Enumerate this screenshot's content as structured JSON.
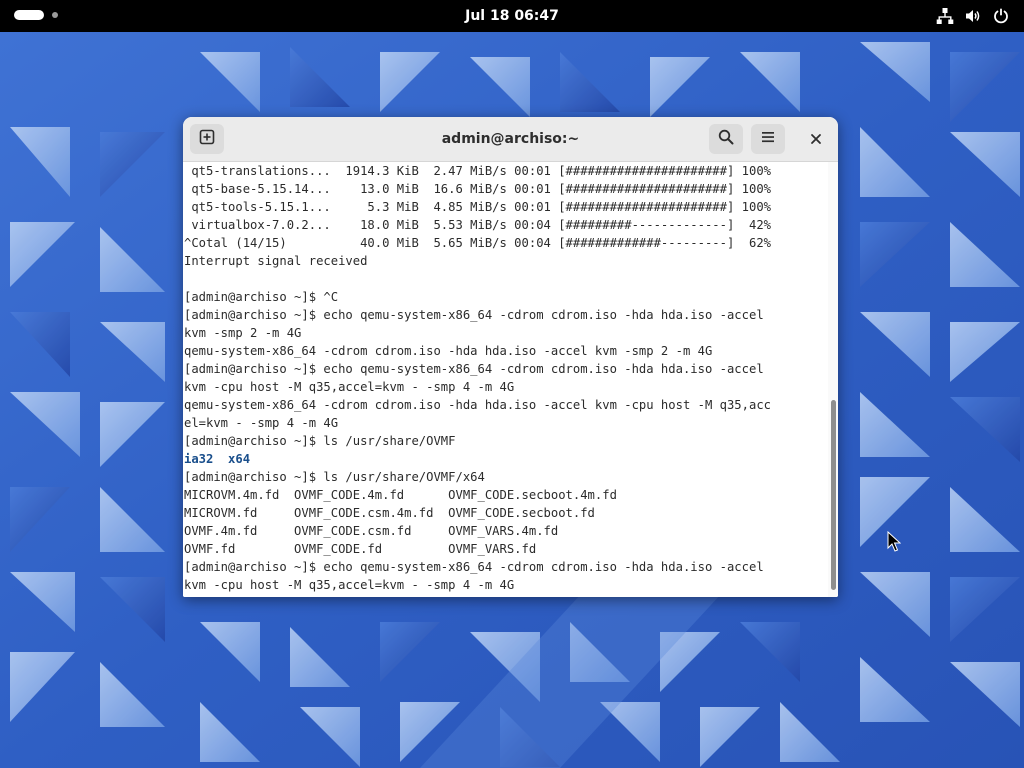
{
  "topbar": {
    "clock": "Jul 18  06:47",
    "icons": [
      "network-icon",
      "volume-icon",
      "power-icon"
    ]
  },
  "terminal": {
    "title": "admin@archiso:~",
    "buttons": [
      "new-tab-icon",
      "search-icon",
      "hamburger-menu-icon",
      "close-icon"
    ],
    "lines": [
      " qt5-translations...  1914.3 KiB  2.47 MiB/s 00:01 [######################] 100%",
      " qt5-base-5.15.14...    13.0 MiB  16.6 MiB/s 00:01 [######################] 100%",
      " qt5-tools-5.15.1...     5.3 MiB  4.85 MiB/s 00:01 [######################] 100%",
      " virtualbox-7.0.2...    18.0 MiB  5.53 MiB/s 00:04 [#########-------------]  42%",
      "^Cotal (14/15)          40.0 MiB  5.65 MiB/s 00:04 [#############---------]  62%",
      "Interrupt signal received",
      "",
      "[admin@archiso ~]$ ^C",
      "[admin@archiso ~]$ echo qemu-system-x86_64 -cdrom cdrom.iso -hda hda.iso -accel",
      "kvm -smp 2 -m 4G",
      "qemu-system-x86_64 -cdrom cdrom.iso -hda hda.iso -accel kvm -smp 2 -m 4G",
      "[admin@archiso ~]$ echo qemu-system-x86_64 -cdrom cdrom.iso -hda hda.iso -accel",
      "kvm -cpu host -M q35,accel=kvm - -smp 4 -m 4G",
      "qemu-system-x86_64 -cdrom cdrom.iso -hda hda.iso -accel kvm -cpu host -M q35,acc",
      "el=kvm - -smp 4 -m 4G",
      "[admin@archiso ~]$ ls /usr/share/OVMF",
      "ia32  x64",
      "[admin@archiso ~]$ ls /usr/share/OVMF/x64",
      "MICROVM.4m.fd  OVMF_CODE.4m.fd      OVMF_CODE.secboot.4m.fd",
      "MICROVM.fd     OVMF_CODE.csm.4m.fd  OVMF_CODE.secboot.fd",
      "OVMF.4m.fd     OVMF_CODE.csm.fd     OVMF_VARS.4m.fd",
      "OVMF.fd        OVMF_CODE.fd         OVMF_VARS.fd",
      "[admin@archiso ~]$ echo qemu-system-x86_64 -cdrom cdrom.iso -hda hda.iso -accel",
      "kvm -cpu host -M q35,accel=kvm - -smp 4 -m 4G"
    ]
  },
  "colors": {
    "wallpaper_base": "#2f5fc4",
    "wallpaper_light": "#8fb4ec",
    "wallpaper_dark": "#1f47a6",
    "directory_text": "#1a4f8c"
  }
}
